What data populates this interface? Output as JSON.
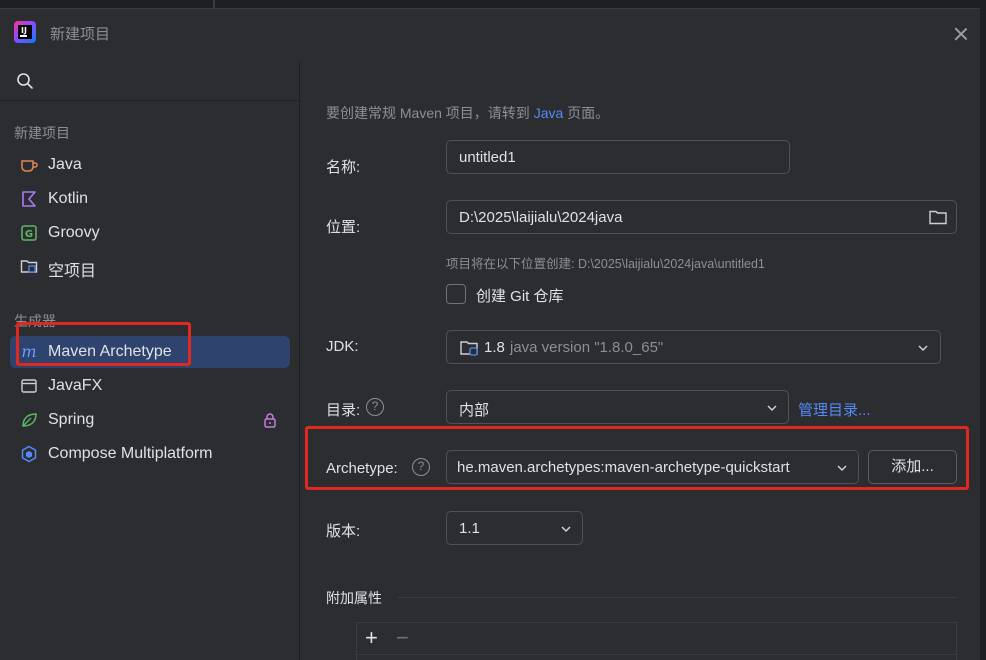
{
  "window": {
    "title": "新建项目"
  },
  "sidebar": {
    "new_project_section": "新建项目",
    "new_project_items": [
      {
        "label": "Java",
        "icon": "java-cup-icon"
      },
      {
        "label": "Kotlin",
        "icon": "kotlin-icon"
      },
      {
        "label": "Groovy",
        "icon": "groovy-icon"
      },
      {
        "label": "空项目",
        "icon": "empty-project-icon"
      }
    ],
    "generators_section": "生成器",
    "generator_items": [
      {
        "label": "Maven Archetype",
        "icon": "maven-icon",
        "selected": true
      },
      {
        "label": "JavaFX",
        "icon": "javafx-icon"
      },
      {
        "label": "Spring",
        "icon": "spring-leaf-icon",
        "locked": true
      },
      {
        "label": "Compose Multiplatform",
        "icon": "compose-icon"
      }
    ]
  },
  "main": {
    "hint_prefix": "要创建常规 Maven 项目，请转到 ",
    "hint_link": "Java",
    "hint_suffix": " 页面。",
    "name_label": "名称:",
    "name_value": "untitled1",
    "location_label": "位置:",
    "location_value": "D:\\2025\\laijialu\\2024java",
    "location_hint": "项目将在以下位置创建: D:\\2025\\laijialu\\2024java\\untitled1",
    "git_checkbox_label": "创建 Git 仓库",
    "git_checked": false,
    "jdk_label": "JDK:",
    "jdk_version": "1.8",
    "jdk_detail": "java version \"1.8.0_65\"",
    "catalog_label": "目录:",
    "catalog_value": "内部",
    "manage_catalogs_link": "管理目录...",
    "archetype_label": "Archetype:",
    "archetype_value": "he.maven.archetypes:maven-archetype-quickstart",
    "add_button": "添加...",
    "version_label": "版本:",
    "version_value": "1.1",
    "extra_props_label": "附加属性",
    "add_prop": "+",
    "remove_prop": "−"
  },
  "colors": {
    "accent_link": "#548af7",
    "selection": "#2e436e",
    "annotation_red": "#e0281e"
  }
}
